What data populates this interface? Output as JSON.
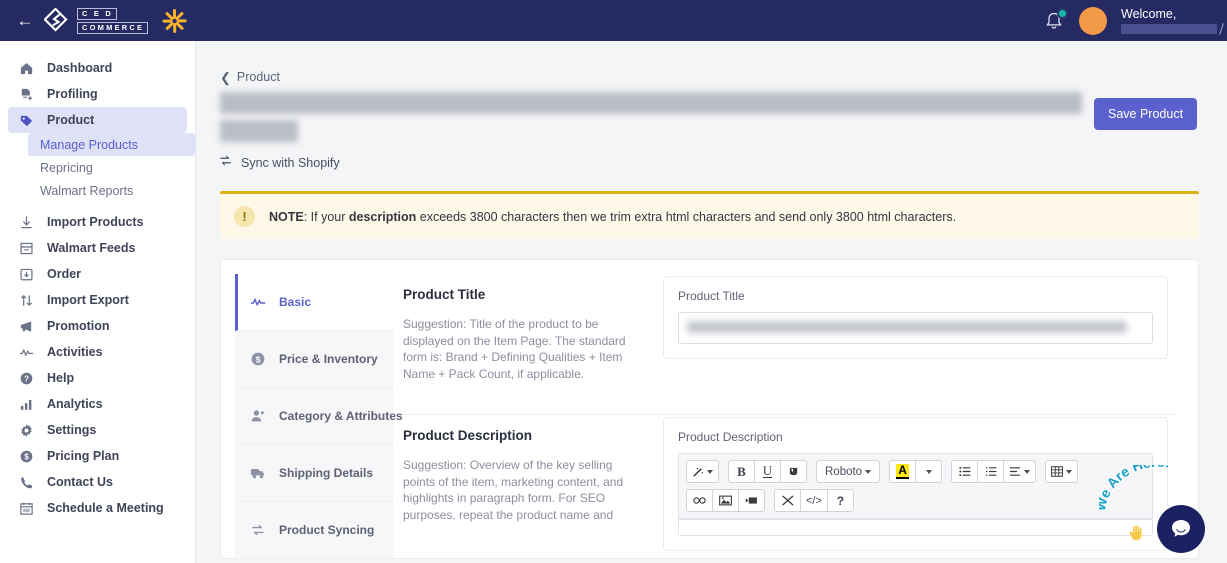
{
  "topbar": {
    "back_icon": "back-arrow-icon",
    "brand_line1": "C E D",
    "brand_line2": "COMMERCE",
    "spark_icon": "walmart-spark-icon",
    "bell_icon": "notification-bell-icon",
    "welcome_label": "Welcome,",
    "username_redacted": ""
  },
  "sidebar": {
    "items": [
      {
        "label": "Dashboard",
        "icon": "home-icon"
      },
      {
        "label": "Profiling",
        "icon": "profiling-icon"
      },
      {
        "label": "Product",
        "icon": "tag-icon"
      },
      {
        "label": "Import Products",
        "icon": "download-icon"
      },
      {
        "label": "Walmart Feeds",
        "icon": "inbox-icon"
      },
      {
        "label": "Order",
        "icon": "order-box-icon"
      },
      {
        "label": "Import Export",
        "icon": "updown-arrows-icon"
      },
      {
        "label": "Promotion",
        "icon": "megaphone-icon"
      },
      {
        "label": "Activities",
        "icon": "pulse-icon"
      },
      {
        "label": "Help",
        "icon": "question-circle-icon"
      },
      {
        "label": "Analytics",
        "icon": "bar-chart-icon"
      },
      {
        "label": "Settings",
        "icon": "gear-icon"
      },
      {
        "label": "Pricing Plan",
        "icon": "dollar-circle-icon"
      },
      {
        "label": "Contact Us",
        "icon": "phone-icon"
      },
      {
        "label": "Schedule a Meeting",
        "icon": "calendar-icon"
      }
    ],
    "subitems": [
      {
        "label": "Manage Products"
      },
      {
        "label": "Repricing"
      },
      {
        "label": "Walmart Reports"
      }
    ]
  },
  "main": {
    "breadcrumb": "Product",
    "page_title_redacted": "",
    "save_label": "Save Product",
    "sync_label": "Sync with Shopify",
    "sync_icon": "sync-arrows-icon"
  },
  "note": {
    "icon": "exclamation-icon",
    "prefix": "NOTE",
    "colon": ": If your ",
    "bold_word": "description",
    "rest": " exceeds 3800 characters then we trim extra html characters and send only 3800 html characters."
  },
  "tabs": [
    {
      "label": "Basic",
      "icon": "pulse-icon",
      "active": true
    },
    {
      "label": "Price & Inventory",
      "icon": "dollar-circle-icon",
      "active": false
    },
    {
      "label": "Category & Attributes",
      "icon": "user-plus-icon",
      "active": false
    },
    {
      "label": "Shipping Details",
      "icon": "truck-icon",
      "active": false
    },
    {
      "label": "Product Syncing",
      "icon": "sync-arrows-icon",
      "active": false
    }
  ],
  "fields": {
    "title": {
      "heading": "Product Title",
      "suggestion": "Suggestion: Title of the product to be displayed on the Item Page. The standard form is: Brand + Defining Qualities + Item Name + Pack Count, if applicable.",
      "control_label": "Product Title",
      "value_redacted": ""
    },
    "description": {
      "heading": "Product Description",
      "suggestion": "Suggestion: Overview of the key selling points of the item, marketing content, and highlights in paragraph form. For SEO purposes, repeat the product name and",
      "control_label": "Product Description"
    }
  },
  "editor": {
    "row1": [
      {
        "group": [
          {
            "name": "magic-wand-icon",
            "glyph": "✨",
            "caret": true
          }
        ]
      },
      {
        "group": [
          {
            "name": "bold-button",
            "glyph": "B",
            "caret": false
          },
          {
            "name": "underline-button",
            "glyph": "U",
            "caret": false
          },
          {
            "name": "clear-format-button",
            "glyph": "■",
            "caret": false
          }
        ]
      },
      {
        "group": [
          {
            "name": "font-family-select",
            "glyph": "Roboto",
            "caret": true
          }
        ]
      },
      {
        "group": [
          {
            "name": "text-color-button",
            "glyph": "A",
            "caret": false
          },
          {
            "name": "text-color-dropdown",
            "glyph": "",
            "caret": true
          }
        ]
      },
      {
        "group": [
          {
            "name": "unordered-list-button",
            "glyph": "☰",
            "caret": false
          },
          {
            "name": "ordered-list-button",
            "glyph": "☰",
            "caret": false
          },
          {
            "name": "align-button",
            "glyph": "☰",
            "caret": true
          }
        ]
      },
      {
        "group": [
          {
            "name": "table-button",
            "glyph": "▦",
            "caret": true
          }
        ]
      }
    ],
    "row2": [
      {
        "group": [
          {
            "name": "link-icon",
            "glyph": "∞",
            "caret": false
          },
          {
            "name": "image-icon",
            "glyph": "⛰",
            "caret": false
          },
          {
            "name": "video-icon",
            "glyph": "▬",
            "caret": false
          }
        ]
      },
      {
        "group": [
          {
            "name": "fullscreen-icon",
            "glyph": "✕",
            "caret": false
          },
          {
            "name": "code-view-button",
            "glyph": "</>",
            "caret": false
          },
          {
            "name": "help-button",
            "glyph": "?",
            "caret": false
          }
        ]
      }
    ]
  },
  "chat": {
    "arc_text": "We Are Here!",
    "hand_icon": "waving-hand-icon",
    "bubble_icon": "chat-bubble-icon",
    "arc_color": "#18a0c9",
    "bubble_color": "#1c2261"
  },
  "colors": {
    "brand_navy": "#252a63",
    "accent_indigo": "#5a61cf",
    "walmart_yellow": "#f8b42c",
    "note_yellow": "#d9b318",
    "note_bg": "#fdf8e7",
    "page_bg": "#f4f5f7"
  }
}
